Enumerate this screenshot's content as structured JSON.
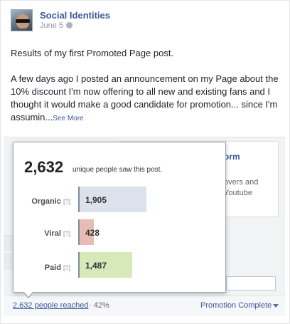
{
  "post": {
    "page_name": "Social Identities",
    "date": "June 5",
    "paragraph1": "Results of my first Promoted Page post.",
    "paragraph2": "A few days ago I posted an announcement on my Page about the 10% discount I'm now offering to all new and existing fans and I thought it would make a good candidate for promotion... since I'm assumin...",
    "see_more": "See More"
  },
  "preview": {
    "title_fragment": "orm",
    "desc_fragment": "overs and\nYoutube"
  },
  "popup": {
    "reach_count": "2,632",
    "reach_caption": "unique people saw this post.",
    "rows": [
      {
        "label": "Organic",
        "help": "[?]",
        "value": "1,905",
        "color": "#dce2ec"
      },
      {
        "label": "Viral",
        "help": "[?]",
        "value": "428",
        "color": "#e5bcb6"
      },
      {
        "label": "Paid",
        "help": "[?]",
        "value": "1,487",
        "color": "#d7e8b9"
      }
    ]
  },
  "footer": {
    "people_reached": "2,632 people reached",
    "percent": "· 42%",
    "promotion_status": "Promotion Complete"
  },
  "colors": {
    "link": "#3b5998",
    "organic": "#dce2ec",
    "viral": "#e5bcb6",
    "paid": "#d7e8b9"
  }
}
